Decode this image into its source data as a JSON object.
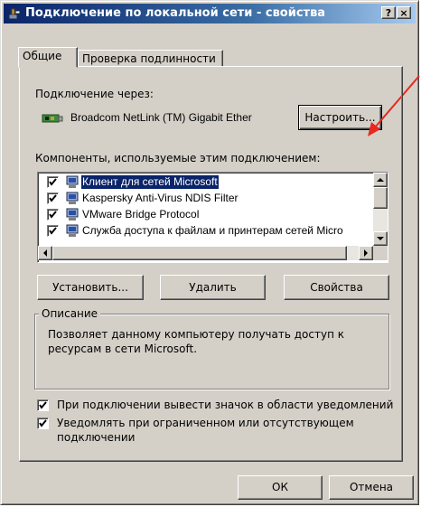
{
  "window": {
    "title": "Подключение по локальной сети - свойства",
    "help_label": "?",
    "close_label": "×"
  },
  "tabs": [
    {
      "label": "Общие",
      "active": true
    },
    {
      "label": "Проверка подлинности",
      "active": false
    }
  ],
  "connection": {
    "label": "Подключение через:",
    "adapter_name": "Broadcom NetLink (TM) Gigabit Ether",
    "configure_label": "Настроить..."
  },
  "components": {
    "label": "Компоненты, используемые этим подключением:",
    "items": [
      {
        "label": "Клиент для сетей Microsoft",
        "checked": true,
        "selected": true
      },
      {
        "label": "Kaspersky Anti-Virus NDIS Filter",
        "checked": true,
        "selected": false
      },
      {
        "label": "VMware Bridge Protocol",
        "checked": true,
        "selected": false
      },
      {
        "label": "Служба доступа к файлам и принтерам сетей Micro",
        "checked": true,
        "selected": false
      }
    ]
  },
  "buttons": {
    "install": "Установить...",
    "remove": "Удалить",
    "properties": "Свойства",
    "ok": "ОК",
    "cancel": "Отмена"
  },
  "description": {
    "legend": "Описание",
    "line1": "Позволяет данному компьютеру получать доступ к",
    "line2": "ресурсам в сети Microsoft."
  },
  "options": {
    "show_icon_label": "При подключении вывести значок в области уведомлений",
    "show_icon_checked": true,
    "notify_line1": "Уведомлять при ограниченном или отсутствующем",
    "notify_line2": "подключении",
    "notify_checked": true
  },
  "colors": {
    "face": "#d4d0c8",
    "titlebar": "#0a246a",
    "selection": "#0a246a",
    "arrow": "#e8281e"
  }
}
